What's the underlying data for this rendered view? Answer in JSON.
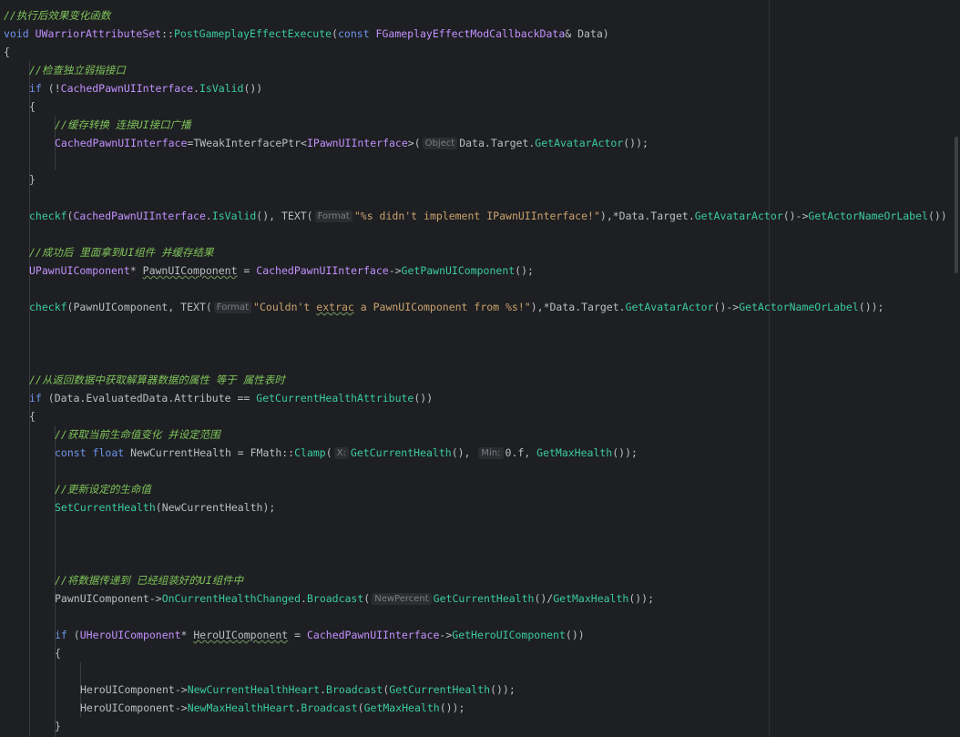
{
  "colors": {
    "background": "#1e1f22",
    "comment": "#7ec45a",
    "keyword": "#6c95eb",
    "type": "#c191ff",
    "function": "#39cc9b",
    "string": "#c9a26d",
    "plain": "#bcbec4",
    "hint": "#7a7e85"
  },
  "code": {
    "l1": "//执行后效果变化函数",
    "l2a": "void ",
    "l2b": "UWarriorAttributeSet",
    "l2c": "::",
    "l2d": "PostGameplayEffectExecute",
    "l2e": "(",
    "l2f": "const ",
    "l2g": "FGameplayEffectModCallbackData",
    "l2h": "& Data)",
    "l3": "{",
    "l4": "//检查独立弱指接口",
    "l5a": "if ",
    "l5b": "(!",
    "l5c": "CachedPawnUIInterface",
    "l5d": ".",
    "l5e": "IsValid",
    "l5f": "())",
    "l6": "{",
    "l7": "//缓存转换 连接UI接口广播",
    "l8a": "CachedPawnUIInterface",
    "l8b": "=",
    "l8c": "TWeakInterfacePtr",
    "l8d": "<",
    "l8e": "IPawnUIInterface",
    "l8f": ">(",
    "l8hint": "Object",
    "l8g": "Data.Target.",
    "l8h": "GetAvatarActor",
    "l8i": "());",
    "l10": "}",
    "l12a": "checkf",
    "l12b": "(",
    "l12c": "CachedPawnUIInterface",
    "l12d": ".",
    "l12e": "IsValid",
    "l12f": "(), TEXT(",
    "l12hint": "Format",
    "l12g": "\"%s didn't implement IPawnUIInterface!\"",
    "l12h": "),*Data.Target.",
    "l12i": "GetAvatarActor",
    "l12j": "()->",
    "l12k": "GetActorNameOrLabel",
    "l12l": "())",
    "l14": "//成功后 里面拿到UI组件 并缓存结果",
    "l15a": "UPawnUIComponent",
    "l15b": "* ",
    "l15c": "PawnUIComponent",
    "l15d": " = ",
    "l15e": "CachedPawnUIInterface",
    "l15f": "->",
    "l15g": "GetPawnUIComponent",
    "l15h": "();",
    "l17a": "checkf",
    "l17b": "(PawnUIComponent, TEXT(",
    "l17hint": "Format",
    "l17c": "\"Couldn't ",
    "l17d": "extrac",
    "l17e": " a PawnUIComponent from %s!\"",
    "l17f": "),*Data.Target.",
    "l17g": "GetAvatarActor",
    "l17h": "()->",
    "l17i": "GetActorNameOrLabel",
    "l17j": "());",
    "l21": "//从返回数据中获取解算器数据的属性 等于 属性表时",
    "l22a": "if ",
    "l22b": "(Data.EvaluatedData.Attribute == ",
    "l22c": "GetCurrentHealthAttribute",
    "l22d": "())",
    "l23": "{",
    "l24": "//获取当前生命值变化 并设定范围",
    "l25a": "const ",
    "l25b": "float ",
    "l25c": "NewCurrentHealth = FMath::",
    "l25d": "Clamp",
    "l25e": "(",
    "l25hint1": "X:",
    "l25f": "GetCurrentHealth",
    "l25g": "(), ",
    "l25hint2": "Min:",
    "l25h": "0.f, ",
    "l25i": "GetMaxHealth",
    "l25j": "());",
    "l27": "//更新设定的生命值",
    "l28a": "SetCurrentHealth",
    "l28b": "(NewCurrentHealth);",
    "l32": "//将数据传递到 已经组装好的UI组件中",
    "l33a": "PawnUIComponent->",
    "l33b": "OnCurrentHealthChanged",
    "l33c": ".",
    "l33d": "Broadcast",
    "l33e": "(",
    "l33hint": "NewPercent",
    "l33f": "GetCurrentHealth",
    "l33g": "()/",
    "l33h": "GetMaxHealth",
    "l33i": "());",
    "l35a": "if ",
    "l35b": "(",
    "l35c": "UHeroUIComponent",
    "l35d": "* ",
    "l35e": "HeroUIComponent",
    "l35f": " = ",
    "l35g": "CachedPawnUIInterface",
    "l35h": "->",
    "l35i": "GetHeroUIComponent",
    "l35j": "())",
    "l36": "{",
    "l38a": "HeroUIComponent->",
    "l38b": "NewCurrentHealthHeart",
    "l38c": ".",
    "l38d": "Broadcast",
    "l38e": "(",
    "l38f": "GetCurrentHealth",
    "l38g": "());",
    "l39a": "HeroUIComponent->",
    "l39b": "NewMaxHealthHeart",
    "l39c": ".",
    "l39d": "Broadcast",
    "l39e": "(",
    "l39f": "GetMaxHealth",
    "l39g": "());",
    "l40": "}"
  }
}
